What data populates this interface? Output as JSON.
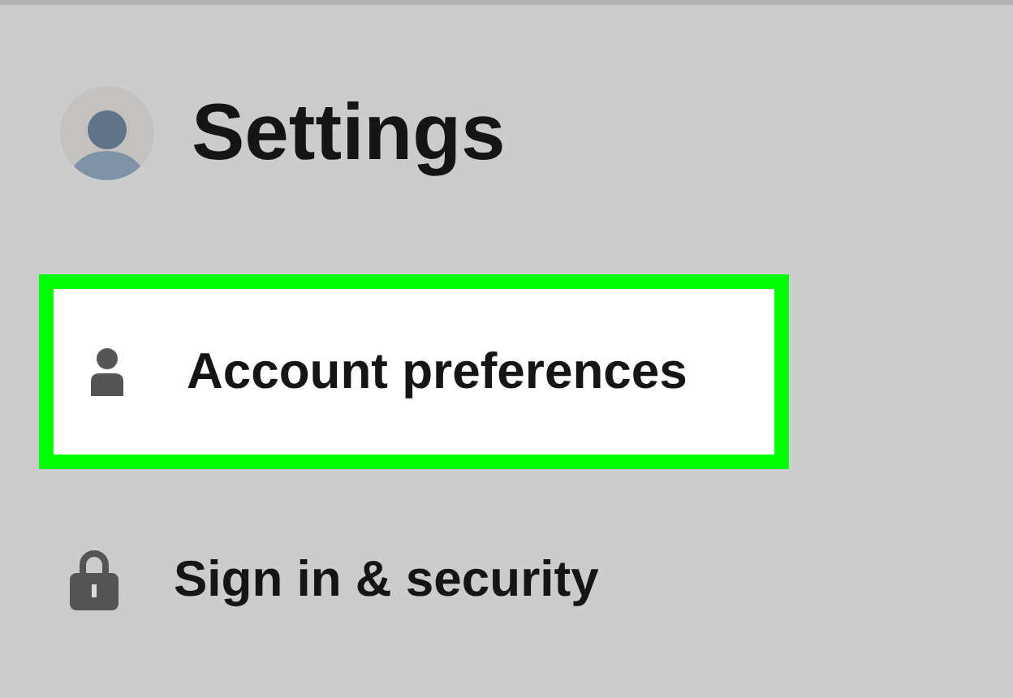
{
  "header": {
    "title": "Settings"
  },
  "items": [
    {
      "label": "Account preferences",
      "kind": "person",
      "selected": true
    },
    {
      "label": "Sign in & security",
      "kind": "lock",
      "selected": false
    }
  ]
}
